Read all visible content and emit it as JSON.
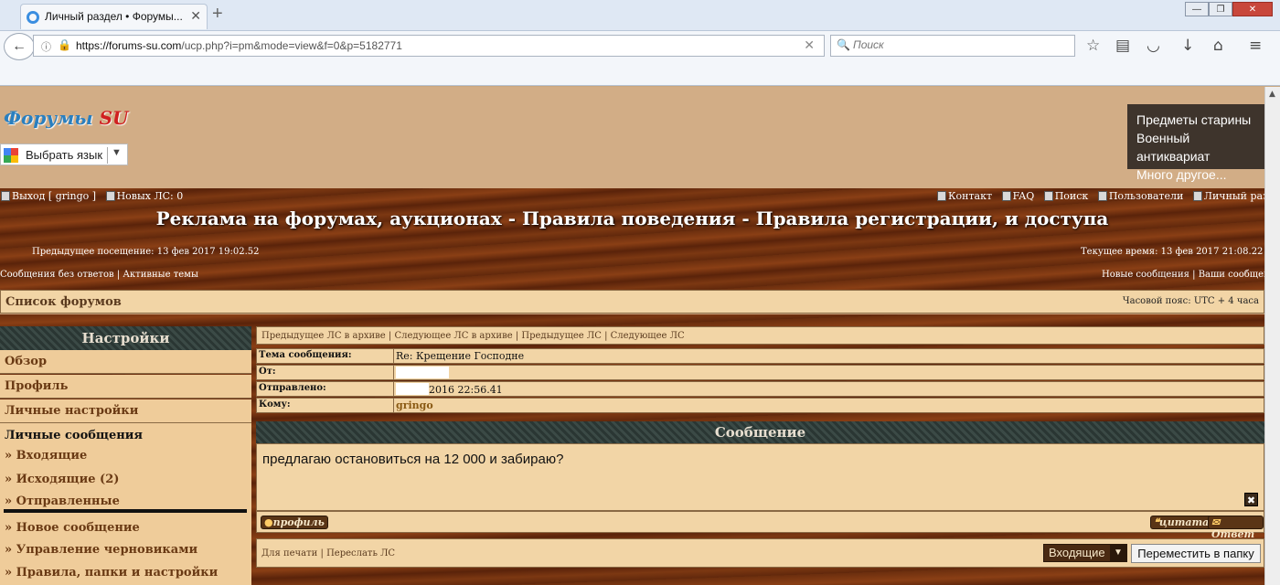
{
  "browser": {
    "tab_title": "Личный раздел • Форумы...",
    "url_host": "https://forums-su.com",
    "url_path": "/ucp.php?i=pm&mode=view&f=0&p=5182771",
    "search_placeholder": "Поиск"
  },
  "header": {
    "logo_main": "Форумы ",
    "logo_su": "SU",
    "lang_label": "Выбрать язык",
    "ad_lines": [
      "Предметы старины",
      "Военный антиквариат",
      "Много другое..."
    ]
  },
  "topbar": {
    "logout": "Выход [ gringo ]",
    "new_pm": "Новых ЛС: 0",
    "contact": "Контакт",
    "faq": "FAQ",
    "search": "Поиск",
    "users": "Пользователи",
    "ucp": "Личный раздел"
  },
  "board_title": "Реклама на форумах, аукционах - Правила поведения - Правила регистрации, и доступа",
  "last_visit": "Предыдущее посещение: 13 фев 2017 19:02.52",
  "current_time": "Текущее время: 13 фев 2017 21:08.22",
  "sublinks": {
    "left": [
      "Сообщения без ответов",
      "Активные темы"
    ],
    "right": [
      "Новые сообщения",
      "Ваши сообщения"
    ]
  },
  "breadcrumb": "Список форумов",
  "timezone": "Часовой пояс: UTC + 4 часа",
  "sidebar": {
    "title": "Настройки",
    "items": [
      "Обзор",
      "Профиль",
      "Личные настройки"
    ],
    "group_title": "Личные сообщения",
    "sub_items": [
      "» Входящие",
      "» Исходящие (2)",
      "» Отправленные",
      "» Новое сообщение",
      "» Управление черновиками",
      "» Правила, папки и настройки"
    ]
  },
  "message": {
    "nav": [
      "Предыдущее ЛС в архиве",
      "Следующее ЛС в архиве",
      "Предыдущее ЛС",
      "Следующее ЛС"
    ],
    "labels": {
      "subject": "Тема сообщения:",
      "from": "От:",
      "sent": "Отправлено:",
      "to": "Кому:"
    },
    "subject": "Re: Крещение Господне",
    "sent_suffix": "2016 22:56.41",
    "to": "gringo",
    "section_title": "Сообщение",
    "body": "предлагаю остановиться на 12 000 и забираю?",
    "profile_btn": "профиль",
    "quote_btn": "цитата",
    "reply_btn": "Ответ",
    "print_link": "Для печати",
    "forward_link": "Переслать ЛС",
    "folder_selected": "Входящие",
    "move_btn": "Переместить в папку"
  }
}
